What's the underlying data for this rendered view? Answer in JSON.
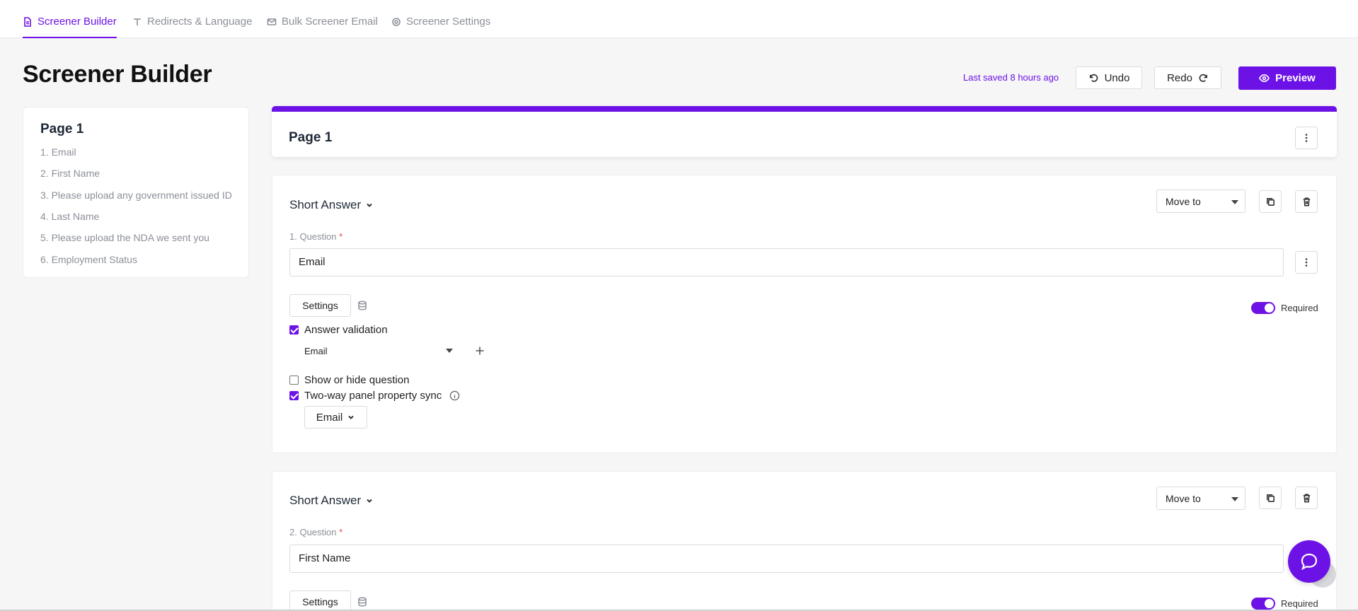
{
  "tabs": [
    {
      "label": "Screener Builder",
      "icon": "document-icon",
      "active": true
    },
    {
      "label": "Redirects & Language",
      "icon": "text-icon",
      "active": false
    },
    {
      "label": "Bulk Screener Email",
      "icon": "mail-icon",
      "active": false
    },
    {
      "label": "Screener Settings",
      "icon": "gear-icon",
      "active": false
    }
  ],
  "header": {
    "title": "Screener Builder",
    "last_saved": "Last saved 8 hours ago",
    "undo_label": "Undo",
    "redo_label": "Redo",
    "preview_label": "Preview"
  },
  "sidebar": {
    "title": "Page 1",
    "items": [
      {
        "label": "1. Email"
      },
      {
        "label": "2. First Name"
      },
      {
        "label": "3. Please upload any government issued ID"
      },
      {
        "label": "4. Last Name"
      },
      {
        "label": "5. Please upload the NDA we sent you"
      },
      {
        "label": "6. Employment Status"
      }
    ]
  },
  "page_card": {
    "title": "Page 1"
  },
  "questions": [
    {
      "type": "Short Answer",
      "move_to": "Move to",
      "label": "1. Question",
      "required_mark": "*",
      "value": "Email",
      "settings_label": "Settings",
      "required_label": "Required",
      "answer_validation_label": "Answer validation",
      "answer_validation_checked": true,
      "validation_value": "Email",
      "show_hide_label": "Show or hide question",
      "show_hide_checked": false,
      "sync_label": "Two-way panel property sync",
      "sync_checked": true,
      "sync_value": "Email"
    },
    {
      "type": "Short Answer",
      "move_to": "Move to",
      "label": "2. Question",
      "required_mark": "*",
      "value": "First Name",
      "settings_label": "Settings",
      "required_label": "Required"
    }
  ],
  "colors": {
    "accent": "#6d12e6",
    "muted": "#8b8f98",
    "required": "#e5484d"
  }
}
